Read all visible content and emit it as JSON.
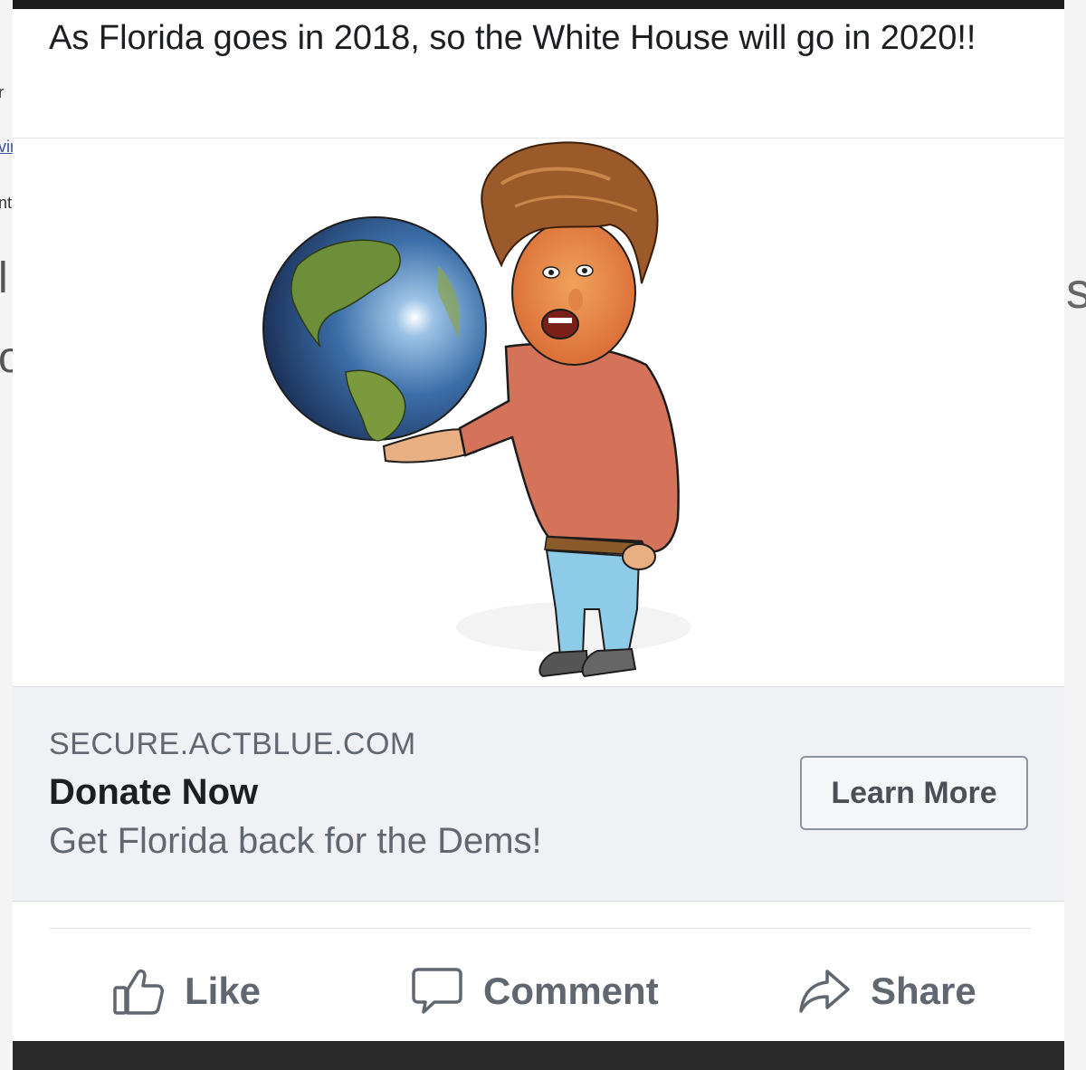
{
  "post": {
    "text": "As Florida goes in 2018, so the White House will go in 2020!!"
  },
  "image": {
    "description_icon": "cartoon-figure-holding-globe"
  },
  "link_preview": {
    "domain": "SECURE.ACTBLUE.COM",
    "title": "Donate Now",
    "description": "Get Florida back for the Dems!",
    "cta_label": "Learn More"
  },
  "actions": {
    "like_label": "Like",
    "like_icon": "thumbs-up-icon",
    "comment_label": "Comment",
    "comment_icon": "speech-bubble-icon",
    "share_label": "Share",
    "share_icon": "share-arrow-icon"
  },
  "background": {
    "left_fragments": [
      "r",
      "vir",
      "nt",
      "l",
      "o"
    ],
    "right_fragment": "s"
  },
  "colors": {
    "card_bg": "#ffffff",
    "link_box_bg": "#f0f1f4",
    "text_primary": "#1c1e21",
    "text_secondary": "#606770",
    "button_border": "#8d949e"
  }
}
